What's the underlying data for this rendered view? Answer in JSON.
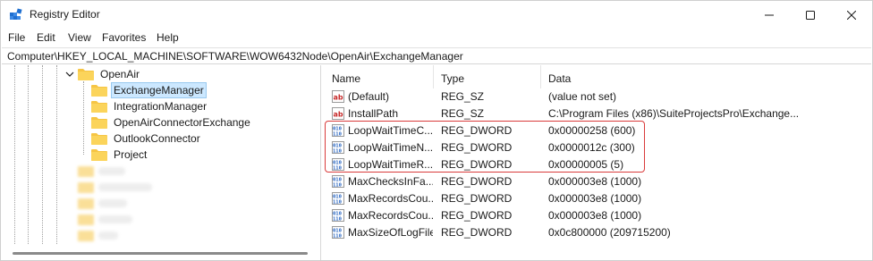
{
  "window": {
    "title": "Registry Editor"
  },
  "menu": {
    "items": [
      "File",
      "Edit",
      "View",
      "Favorites",
      "Help"
    ]
  },
  "address": {
    "path": "Computer\\HKEY_LOCAL_MACHINE\\SOFTWARE\\WOW6432Node\\OpenAir\\ExchangeManager"
  },
  "tree": {
    "parent": "OpenAir",
    "children": [
      "ExchangeManager",
      "IntegrationManager",
      "OpenAirConnectorExchange",
      "OutlookConnector",
      "Project"
    ],
    "selected": "ExchangeManager"
  },
  "list": {
    "columns": [
      "Name",
      "Type",
      "Data"
    ],
    "rows": [
      {
        "name": "(Default)",
        "type": "REG_SZ",
        "data": "(value not set)",
        "icon": "string-value-icon"
      },
      {
        "name": "InstallPath",
        "type": "REG_SZ",
        "data": "C:\\Program Files (x86)\\SuiteProjectsPro\\Exchange...",
        "icon": "string-value-icon"
      },
      {
        "name": "LoopWaitTimeC...",
        "type": "REG_DWORD",
        "data": "0x00000258 (600)",
        "icon": "binary-value-icon"
      },
      {
        "name": "LoopWaitTimeN...",
        "type": "REG_DWORD",
        "data": "0x0000012c (300)",
        "icon": "binary-value-icon"
      },
      {
        "name": "LoopWaitTimeR...",
        "type": "REG_DWORD",
        "data": "0x00000005 (5)",
        "icon": "binary-value-icon"
      },
      {
        "name": "MaxChecksInFa...",
        "type": "REG_DWORD",
        "data": "0x000003e8 (1000)",
        "icon": "binary-value-icon"
      },
      {
        "name": "MaxRecordsCou...",
        "type": "REG_DWORD",
        "data": "0x000003e8 (1000)",
        "icon": "binary-value-icon"
      },
      {
        "name": "MaxRecordsCou...",
        "type": "REG_DWORD",
        "data": "0x000003e8 (1000)",
        "icon": "binary-value-icon"
      },
      {
        "name": "MaxSizeOfLogFile",
        "type": "REG_DWORD",
        "data": "0x0c800000 (209715200)",
        "icon": "binary-value-icon"
      }
    ]
  },
  "colors": {
    "folder": "#f6c544",
    "selection": "#cce8ff",
    "highlight": "#d93b3b"
  }
}
